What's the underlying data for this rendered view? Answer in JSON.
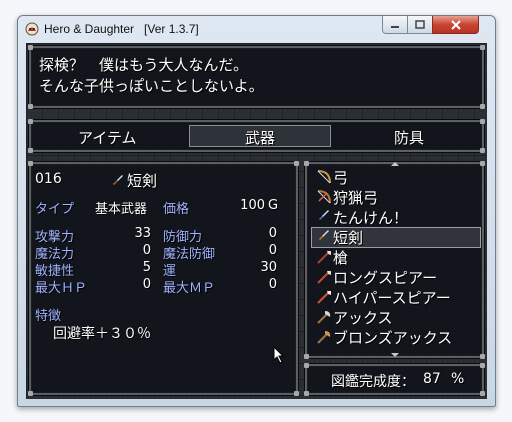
{
  "window": {
    "title": "Hero & Daughter   [Ver 1.3.7]"
  },
  "dialog": {
    "lines": [
      "探検？　僕はもう大人なんだ。",
      "そんな子供っぽいことしないよ。"
    ]
  },
  "tabs": [
    {
      "label": "アイテム",
      "selected": false
    },
    {
      "label": "武器",
      "selected": true
    },
    {
      "label": "防具",
      "selected": false
    }
  ],
  "detail": {
    "id": "016",
    "name": "短剣",
    "type_label": "タイプ",
    "type_value": "基本武器",
    "price_label": "価格",
    "price_value": "100",
    "currency": "G",
    "stats": [
      {
        "label": "攻撃力",
        "value": "33",
        "label2": "防御力",
        "value2": "0"
      },
      {
        "label": "魔法力",
        "value": "0",
        "label2": "魔法防御",
        "value2": "0"
      },
      {
        "label": "敏捷性",
        "value": "5",
        "label2": "運",
        "value2": "30"
      },
      {
        "label": "最大ＨＰ",
        "value": "0",
        "label2": "最大ＭＰ",
        "value2": "0"
      }
    ],
    "feature_label": "特徴",
    "feature_text": "回避率＋３０％"
  },
  "weapons": [
    {
      "name": "弓",
      "icon": "bow-icon"
    },
    {
      "name": "狩猟弓",
      "icon": "bow-icon"
    },
    {
      "name": "たんけん！",
      "icon": "dagger-icon"
    },
    {
      "name": "短剣",
      "icon": "dagger-icon",
      "selected": true
    },
    {
      "name": "槍",
      "icon": "spear-icon"
    },
    {
      "name": "ロングスピアー",
      "icon": "spear-icon"
    },
    {
      "name": "ハイパースピアー",
      "icon": "spear-icon"
    },
    {
      "name": "アックス",
      "icon": "axe-icon"
    },
    {
      "name": "ブロンズアックス",
      "icon": "axe-icon"
    }
  ],
  "completion": {
    "label": "図鑑完成度：",
    "value": "87",
    "unit": "%"
  },
  "colors": {
    "label_blue": "#9fb3ff",
    "panel_bg": "#0f1218",
    "close_red": "#c74533"
  }
}
